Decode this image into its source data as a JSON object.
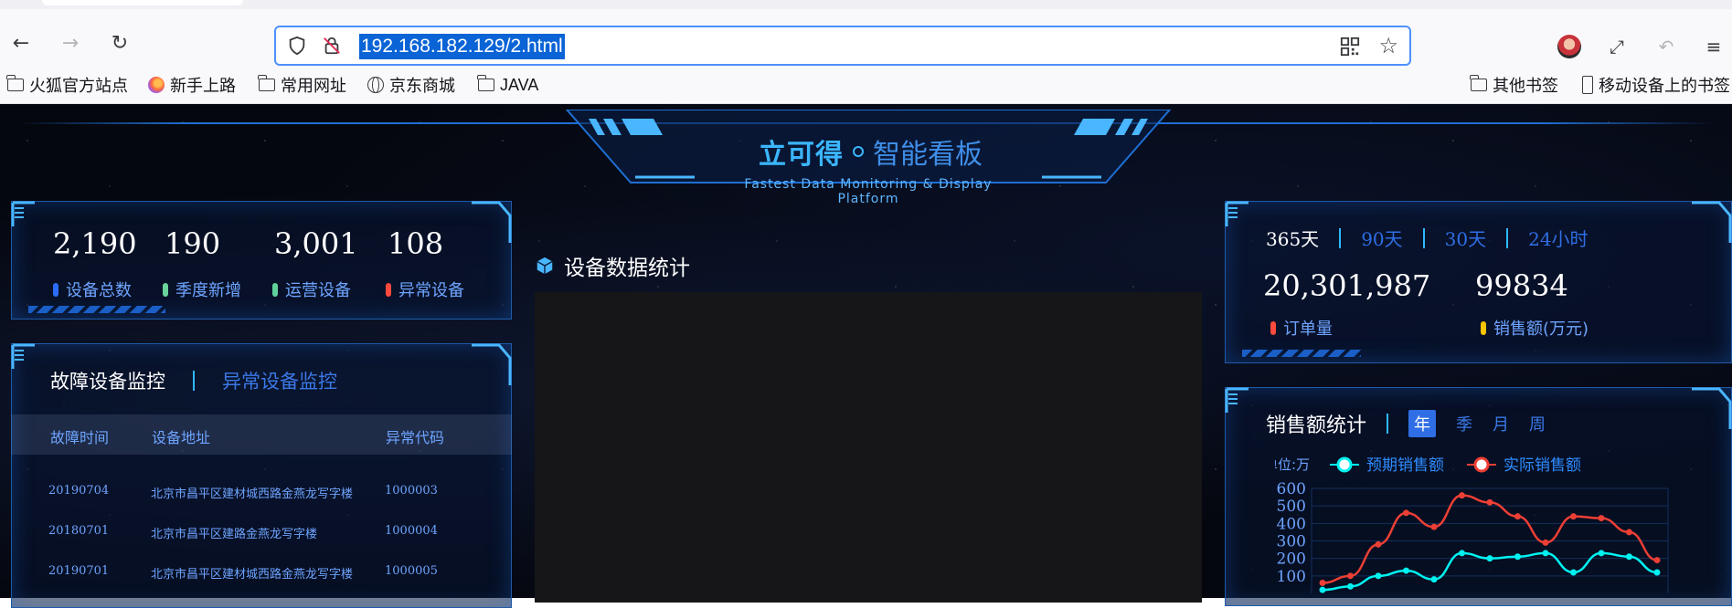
{
  "browser": {
    "url": "192.168.182.129/2.html",
    "bookmarks": [
      "火狐官方站点",
      "新手上路",
      "常用网址",
      "京东商城",
      "JAVA"
    ],
    "bookmarks_right": [
      "其他书签",
      "移动设备上的书签"
    ]
  },
  "header": {
    "logo": "立可得",
    "title": "智能看板",
    "subtitle": "Fastest Data Monitoring & Display Platform"
  },
  "stats": [
    {
      "value": "2,190",
      "label": "设备总数",
      "color": "#2b6dfb"
    },
    {
      "value": "190",
      "label": "季度新增",
      "color": "#6ad39b"
    },
    {
      "value": "3,001",
      "label": "运营设备",
      "color": "#5fd29a"
    },
    {
      "value": "108",
      "label": "异常设备",
      "color": "#ff4a3d"
    }
  ],
  "monitor": {
    "tab_active": "故障设备监控",
    "tab_inactive": "异常设备监控",
    "columns": [
      "故障时间",
      "设备地址",
      "异常代码"
    ],
    "rows": [
      {
        "time": "20190704",
        "addr": "北京市昌平区建材城西路金燕龙写字楼",
        "code": "1000003"
      },
      {
        "time": "20180701",
        "addr": "北京市昌平区建路金燕龙写字楼",
        "code": "1000004"
      },
      {
        "time": "20190701",
        "addr": "北京市昌平区建材城西路金燕龙写字楼",
        "code": "1000005"
      }
    ]
  },
  "center": {
    "title": "设备数据统计"
  },
  "orders": {
    "ranges": [
      "365天",
      "90天",
      "30天",
      "24小时"
    ],
    "active_range": "365天",
    "order_count": "20,301,987",
    "order_label": "订单量",
    "sales": "99834",
    "sales_label": "销售额(万元)",
    "order_color": "#ff4a3d",
    "sales_color": "#ffc400"
  },
  "sales": {
    "title": "销售额统计",
    "periods": [
      "年",
      "季",
      "月",
      "周"
    ],
    "active_period": "年"
  },
  "chart_data": {
    "type": "line",
    "unit_label": "单位:万",
    "ylim": [
      0,
      600
    ],
    "yticks": [
      "600",
      "500",
      "400",
      "300",
      "200",
      "100"
    ],
    "series": [
      {
        "name": "预期销售额",
        "color": "#00f2f1",
        "values": [
          20,
          40,
          100,
          130,
          80,
          230,
          200,
          210,
          230,
          120,
          230,
          210,
          120
        ]
      },
      {
        "name": "实际销售额",
        "color": "#ed3f35",
        "values": [
          60,
          100,
          280,
          460,
          380,
          560,
          520,
          440,
          290,
          440,
          430,
          350,
          190
        ]
      }
    ]
  }
}
